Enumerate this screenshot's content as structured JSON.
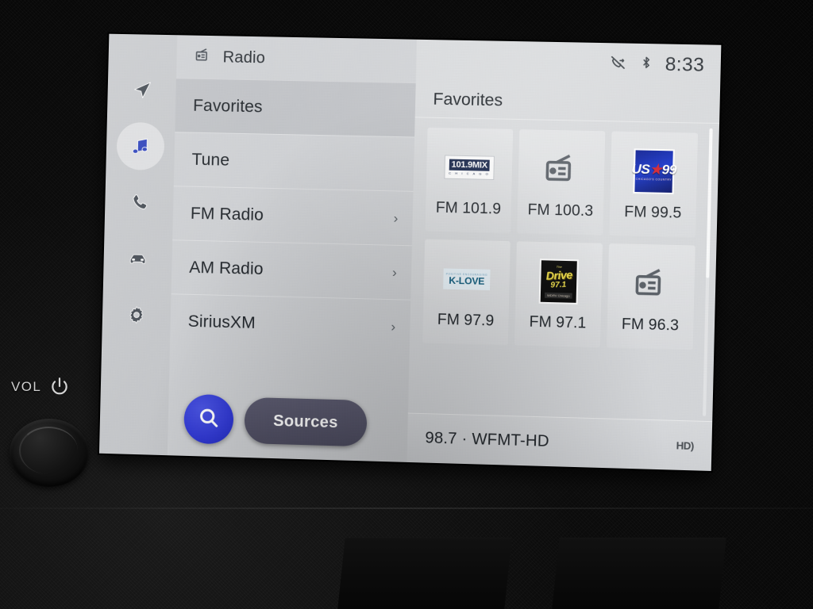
{
  "hardware": {
    "volume_label": "VOL",
    "power_icon": "power-icon",
    "knob": "volume-knob"
  },
  "statusbar": {
    "mute_icon": "call-mute-icon",
    "bluetooth_icon": "bluetooth-icon",
    "time": "8:33"
  },
  "rail": {
    "items": [
      {
        "icon": "navigation-arrow-icon",
        "name": "navigation",
        "active": false
      },
      {
        "icon": "music-note-icon",
        "name": "media",
        "active": true
      },
      {
        "icon": "phone-icon",
        "name": "phone",
        "active": false
      },
      {
        "icon": "car-icon",
        "name": "vehicle",
        "active": false
      },
      {
        "icon": "gear-icon",
        "name": "settings",
        "active": false
      }
    ]
  },
  "menu": {
    "header": {
      "icon": "radio-icon",
      "title": "Radio"
    },
    "items": [
      {
        "label": "Favorites",
        "selected": true,
        "chevron": ""
      },
      {
        "label": "Tune",
        "selected": false,
        "chevron": ""
      },
      {
        "label": "FM Radio",
        "selected": false,
        "chevron": "›"
      },
      {
        "label": "AM Radio",
        "selected": false,
        "chevron": "›"
      },
      {
        "label": "SiriusXM",
        "selected": false,
        "chevron": "›"
      }
    ],
    "search_label": "search-icon",
    "sources_label": "Sources"
  },
  "content": {
    "title": "Favorites",
    "tiles": [
      {
        "label": "FM 101.9",
        "logo": "mix",
        "logo_top": "101.9MIX",
        "logo_bottom": "C H I C A G O"
      },
      {
        "label": "FM 100.3",
        "logo": "generic-radio-icon"
      },
      {
        "label": "FM 99.5",
        "logo": "us99",
        "logo_main": "US",
        "logo_star": "★",
        "logo_num": "99",
        "logo_sub": "CHICAGO'S COUNTRY"
      },
      {
        "label": "FM 97.9",
        "logo": "klove",
        "logo_tiny": "POSITIVE ENCOURAGING",
        "logo_main": "K-LOVE"
      },
      {
        "label": "FM 97.1",
        "logo": "drive",
        "logo_pre": "The",
        "logo_main": "Drive",
        "logo_num": "97.1",
        "logo_sub": "WDRV Chicago"
      },
      {
        "label": "FM 96.3",
        "logo": "generic-radio-icon"
      }
    ]
  },
  "nowplaying": {
    "text": "98.7 · WFMT-HD",
    "hd_icon": "hd-radio-icon",
    "hd_text": "HD)"
  }
}
